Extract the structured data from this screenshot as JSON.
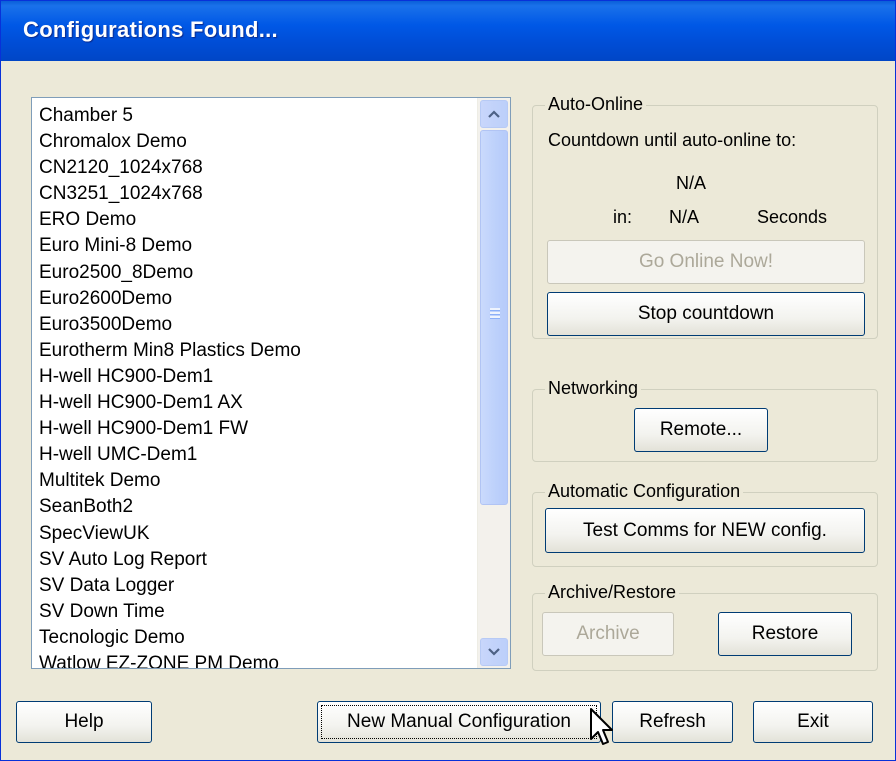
{
  "window": {
    "title": "Configurations Found..."
  },
  "config_list": {
    "items": [
      "Chamber 5",
      "Chromalox Demo",
      "CN2120_1024x768",
      "CN3251_1024x768",
      "ERO Demo",
      "Euro Mini-8 Demo",
      "Euro2500_8Demo",
      "Euro2600Demo",
      "Euro3500Demo",
      "Eurotherm Min8 Plastics Demo",
      "H-well HC900-Dem1",
      "H-well HC900-Dem1 AX",
      "H-well HC900-Dem1 FW",
      "H-well UMC-Dem1",
      "Multitek Demo",
      "SeanBoth2",
      "SpecViewUK",
      "SV Auto Log Report",
      "SV Data Logger",
      "SV Down Time",
      "Tecnologic Demo",
      "Watlow EZ-ZONE PM Demo"
    ]
  },
  "auto_online": {
    "legend": "Auto-Online",
    "countdown_text": "Countdown until auto-online to:",
    "target_value": "N/A",
    "in_label": "in:",
    "seconds_value": "N/A",
    "seconds_unit": "Seconds",
    "go_online_label": "Go Online Now!",
    "stop_countdown_label": "Stop countdown"
  },
  "networking": {
    "legend": "Networking",
    "remote_label": "Remote..."
  },
  "automatic_configuration": {
    "legend": "Automatic Configuration",
    "test_comms_label": "Test Comms for NEW config."
  },
  "archive_restore": {
    "legend": "Archive/Restore",
    "archive_label": "Archive",
    "restore_label": "Restore"
  },
  "footer": {
    "help_label": "Help",
    "new_manual_label": "New Manual Configuration",
    "refresh_label": "Refresh",
    "exit_label": "Exit"
  }
}
